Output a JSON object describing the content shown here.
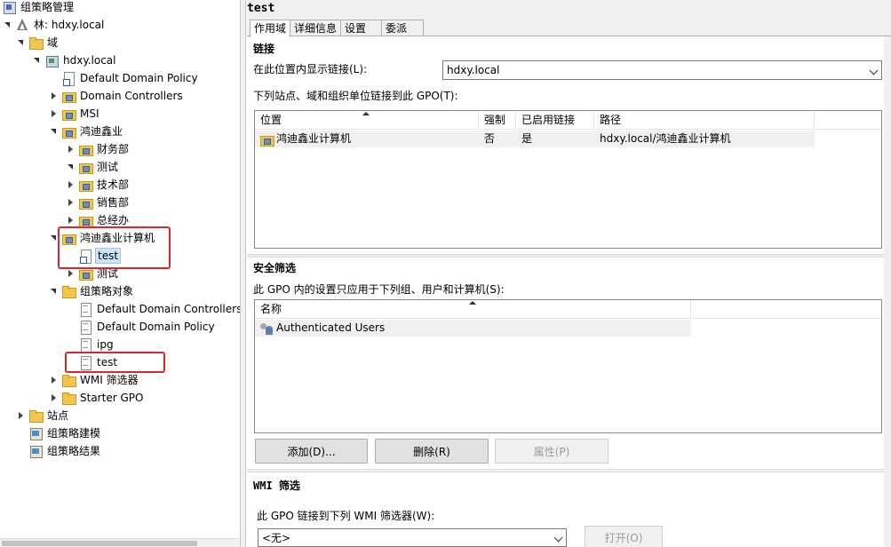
{
  "tree": {
    "items": [
      {
        "label": "组策略管理",
        "icon": "gpm-icon",
        "level": 0,
        "toggle": "none"
      },
      {
        "label": "林: hdxy.local",
        "icon": "forest-icon",
        "level": 0,
        "toggle": "expanded"
      },
      {
        "label": "域",
        "icon": "domains-folder-icon",
        "level": 1,
        "toggle": "expanded"
      },
      {
        "label": "hdxy.local",
        "icon": "domain-icon",
        "level": 2,
        "toggle": "expanded"
      },
      {
        "label": "Default Domain Policy",
        "icon": "gpo-link-icon",
        "level": 3,
        "toggle": "none"
      },
      {
        "label": "Domain Controllers",
        "icon": "ou-icon",
        "level": 3,
        "toggle": "collapsed"
      },
      {
        "label": "MSI",
        "icon": "ou-icon",
        "level": 3,
        "toggle": "collapsed"
      },
      {
        "label": "鸿迪鑫业",
        "icon": "ou-icon",
        "level": 3,
        "toggle": "expanded"
      },
      {
        "label": "财务部",
        "icon": "ou-icon",
        "level": 4,
        "toggle": "collapsed"
      },
      {
        "label": "测试",
        "icon": "ou-icon",
        "level": 4,
        "toggle": "expanded"
      },
      {
        "label": "技术部",
        "icon": "ou-icon",
        "level": 4,
        "toggle": "collapsed"
      },
      {
        "label": "销售部",
        "icon": "ou-icon",
        "level": 4,
        "toggle": "collapsed"
      },
      {
        "label": "总经办",
        "icon": "ou-icon",
        "level": 4,
        "toggle": "collapsed"
      },
      {
        "label": "鸿迪鑫业计算机",
        "icon": "ou-icon",
        "level": 3,
        "toggle": "expanded"
      },
      {
        "label": "test",
        "icon": "gpo-link-icon",
        "level": 4,
        "toggle": "none",
        "selected": true
      },
      {
        "label": "测试",
        "icon": "ou-icon",
        "level": 3,
        "toggle": "collapsed"
      },
      {
        "label": "组策略对象",
        "icon": "gpo-folder-icon",
        "level": 3,
        "toggle": "expanded"
      },
      {
        "label": "Default Domain Controllers",
        "icon": "gpo-icon",
        "level": 4,
        "toggle": "none"
      },
      {
        "label": "Default Domain Policy",
        "icon": "gpo-icon",
        "level": 4,
        "toggle": "none"
      },
      {
        "label": "ipg",
        "icon": "gpo-icon",
        "level": 4,
        "toggle": "none"
      },
      {
        "label": "test",
        "icon": "gpo-icon",
        "level": 4,
        "toggle": "none"
      },
      {
        "label": "WMI 筛选器",
        "icon": "folder-icon",
        "level": 3,
        "toggle": "collapsed"
      },
      {
        "label": "Starter GPO",
        "icon": "folder-icon",
        "level": 3,
        "toggle": "collapsed"
      },
      {
        "label": "站点",
        "icon": "sites-icon",
        "level": 1,
        "toggle": "collapsed"
      },
      {
        "label": "组策略建模",
        "icon": "modeling-icon",
        "level": 1,
        "toggle": "none"
      },
      {
        "label": "组策略结果",
        "icon": "results-icon",
        "level": 1,
        "toggle": "none"
      }
    ]
  },
  "header": {
    "title": "test"
  },
  "tabs": [
    {
      "label": "作用域",
      "active": true
    },
    {
      "label": "详细信息",
      "active": false
    },
    {
      "label": "设置",
      "active": false
    },
    {
      "label": "委派",
      "active": false
    }
  ],
  "links": {
    "heading": "链接",
    "location_label": "在此位置内显示链接(L):",
    "location_value": "hdxy.local",
    "list_label": "下列站点、域和组织单位链接到此 GPO(T):",
    "columns": [
      "位置",
      "强制",
      "已启用链接",
      "路径"
    ],
    "rows": [
      {
        "location": "鸿迪鑫业计算机",
        "enforced": "否",
        "enabled": "是",
        "path": "hdxy.local/鸿迪鑫业计算机"
      }
    ]
  },
  "security": {
    "heading": "安全筛选",
    "description": "此 GPO 内的设置只应用于下列组、用户和计算机(S):",
    "columns": [
      "名称"
    ],
    "rows": [
      "Authenticated Users"
    ],
    "add_label": "添加(D)...",
    "remove_label": "删除(R)",
    "properties_label": "属性(P)"
  },
  "wmi": {
    "heading": "WMI 筛选",
    "description": "此 GPO 链接到下列 WMI 筛选器(W):",
    "value": "<无>",
    "open_label": "打开(O)"
  },
  "colors": {
    "highlight_box": "#e0262b",
    "selection": "#cce4f7"
  }
}
